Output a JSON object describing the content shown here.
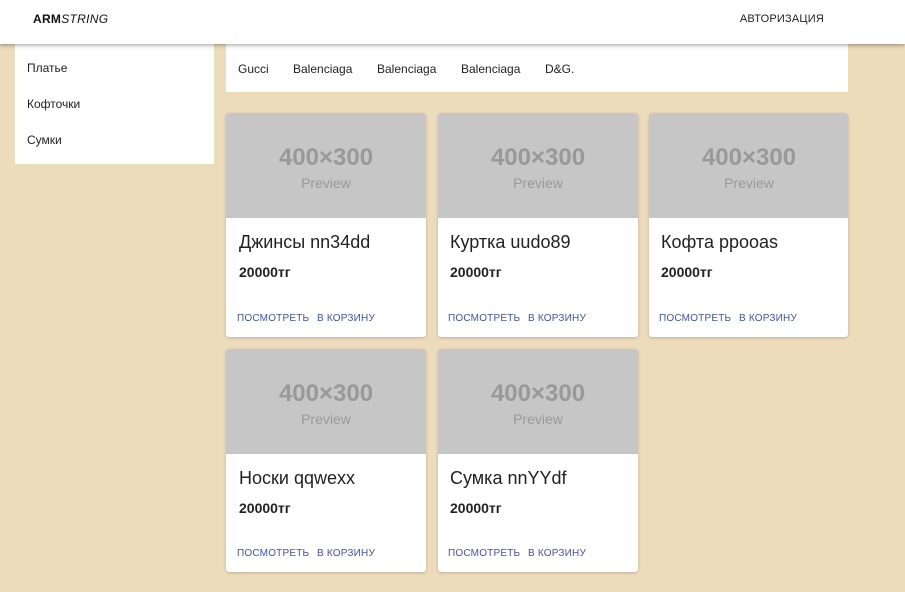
{
  "header": {
    "logo_bold": "ARM",
    "logo_italic": "STRING",
    "auth_label": "АВТОРИЗАЦИЯ"
  },
  "sidebar": {
    "items": [
      {
        "label": "Платье"
      },
      {
        "label": "Кофточки"
      },
      {
        "label": "Сумки"
      }
    ]
  },
  "brands": [
    {
      "label": "Gucci"
    },
    {
      "label": "Balenciaga"
    },
    {
      "label": "Balenciaga"
    },
    {
      "label": "Balenciaga"
    },
    {
      "label": "D&G."
    }
  ],
  "products": [
    {
      "image_text": "400×300",
      "image_sub": "Preview",
      "title": "Джинсы nn34dd",
      "price": "20000тг",
      "view_label": "ПОСМОТРЕТЬ",
      "cart_label": "В КОРЗИНУ"
    },
    {
      "image_text": "400×300",
      "image_sub": "Preview",
      "title": "Куртка uudo89",
      "price": "20000тг",
      "view_label": "ПОСМОТРЕТЬ",
      "cart_label": "В КОРЗИНУ"
    },
    {
      "image_text": "400×300",
      "image_sub": "Preview",
      "title": "Кофта ppooas",
      "price": "20000тг",
      "view_label": "ПОСМОТРЕТЬ",
      "cart_label": "В КОРЗИНУ"
    },
    {
      "image_text": "400×300",
      "image_sub": "Preview",
      "title": "Носки qqwexx",
      "price": "20000тг",
      "view_label": "ПОСМОТРЕТЬ",
      "cart_label": "В КОРЗИНУ"
    },
    {
      "image_text": "400×300",
      "image_sub": "Preview",
      "title": "Сумка nnYYdf",
      "price": "20000тг",
      "view_label": "ПОСМОТРЕТЬ",
      "cart_label": "В КОРЗИНУ"
    }
  ],
  "colors": {
    "background": "#eddcbc",
    "accent": "#3f51b5",
    "placeholder": "#c6c6c6"
  }
}
